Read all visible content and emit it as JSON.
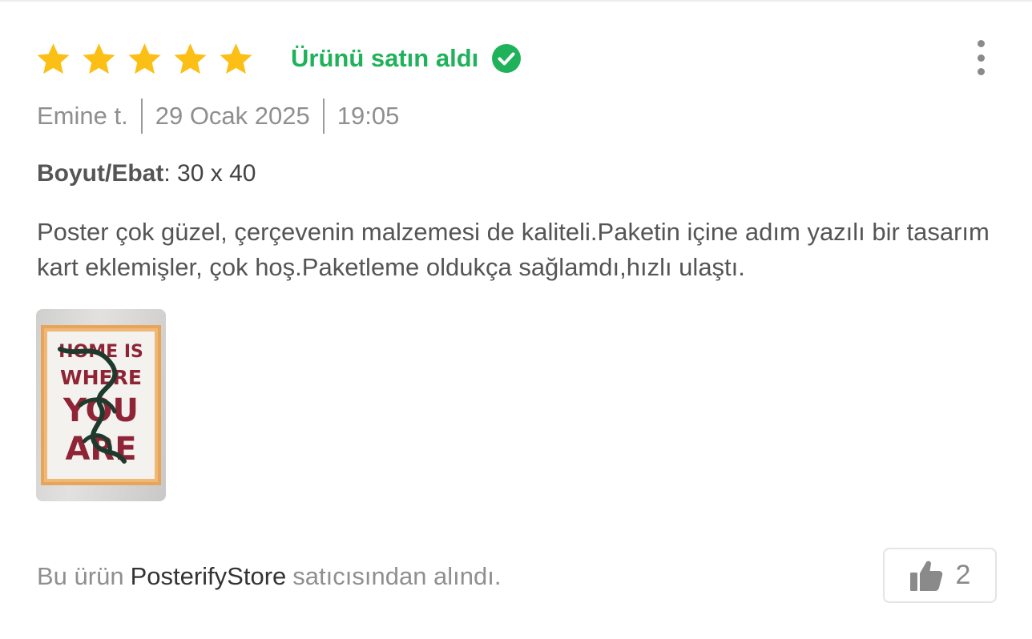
{
  "review": {
    "rating": 5,
    "verified_label": "Ürünü satın aldı",
    "author": "Emine t.",
    "date": "29 Ocak 2025",
    "time": "19:05",
    "attribute": {
      "key": "Boyut/Ebat",
      "separator": ":",
      "value": "30 x 40"
    },
    "comment": "Poster çok güzel, çerçevenin malzemesi de kaliteli.Paketin içine adım yazılı bir tasarım kart eklemişler, çok hoş.Paketleme oldukça sağlamdı,hızlı ulaştı.",
    "photo": {
      "poster_line1": "HOME IS",
      "poster_line2": "WHERE",
      "poster_line3": "YOU",
      "poster_line4": "ARE"
    }
  },
  "seller": {
    "prefix": "Bu ürün",
    "name": "PosterifyStore",
    "suffix": "satıcısından alındı."
  },
  "like": {
    "count": "2"
  },
  "icons": {
    "star": "star-icon",
    "verified": "check-circle-icon",
    "more": "more-vertical-icon",
    "like": "thumbs-up-icon"
  },
  "colors": {
    "star": "#fcbf16",
    "verified": "#1fb25a",
    "muted_text": "#8f8f8f",
    "body_text": "#555555"
  }
}
